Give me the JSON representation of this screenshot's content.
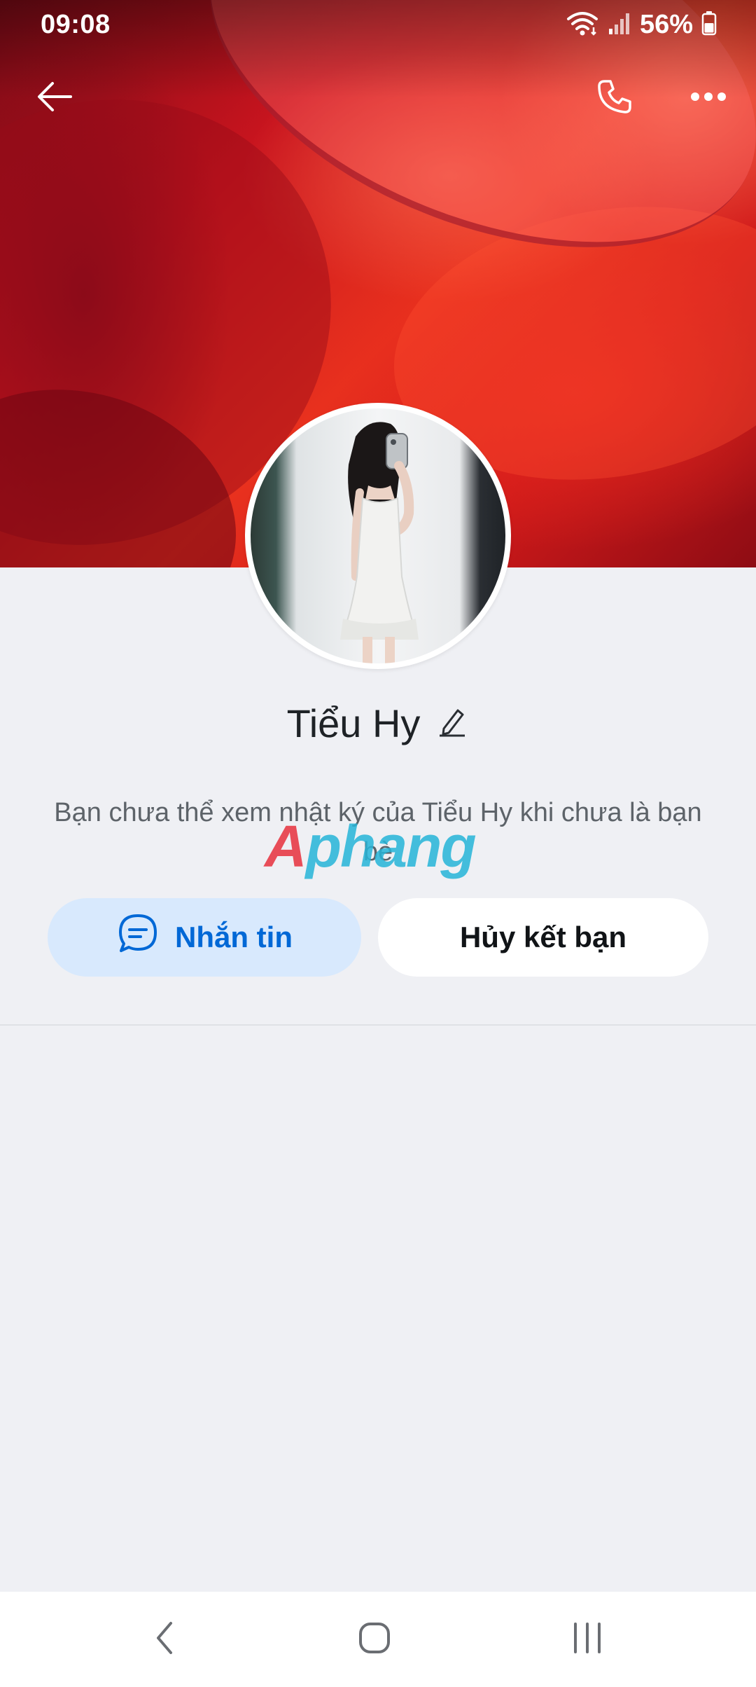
{
  "status_bar": {
    "time": "09:08",
    "battery": "56%"
  },
  "profile": {
    "name": "Tiểu Hy",
    "info_text": "Bạn chưa thể xem nhật ký của Tiểu Hy khi chưa là bạn bè"
  },
  "actions": {
    "message_label": "Nhắn tin",
    "unfriend_label": "Hủy kết bạn"
  },
  "watermark": {
    "part1": "A",
    "part2": "phang"
  },
  "icons": {
    "back": "arrow-left-icon",
    "call": "phone-icon",
    "more": "more-horizontal-icon",
    "edit": "pencil-icon",
    "message": "chat-bubble-icon"
  },
  "colors": {
    "accent": "#0068d6",
    "message_button_bg": "#d8e9fd",
    "page_bg": "#eff0f4"
  }
}
